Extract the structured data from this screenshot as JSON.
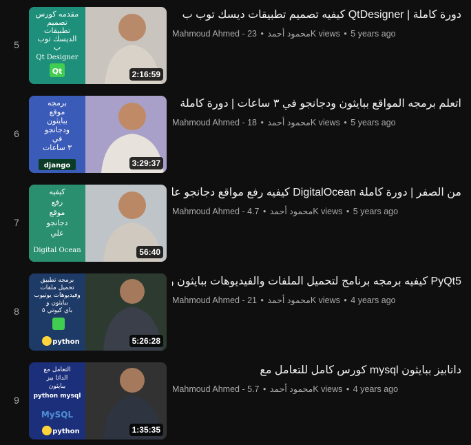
{
  "videos": [
    {
      "index": "5",
      "title": "دورة كاملة | QtDesigner كيفيه تصميم تطبيقات ديسك توب ب",
      "channel": "Mahmoud Ahmed - محمود أحمد",
      "views": "23K views",
      "age": "5 years ago",
      "duration": "2:16:59",
      "thumb_text": [
        "مقدمه كورس",
        "تصميم",
        "تطبيقات",
        "الديسك توب",
        "ب",
        "Qt Designer"
      ],
      "badge": "Qt",
      "panel_color": "#1d8f7a"
    },
    {
      "index": "6",
      "title": "اتعلم برمجه المواقع ببايثون ودجانجو في ٣ ساعات | دورة كاملة",
      "channel": "Mahmoud Ahmed - محمود أحمد",
      "views": "18K views",
      "age": "5 years ago",
      "duration": "3:29:37",
      "thumb_text": [
        "برمجه",
        "موقع",
        "ببايثون",
        "ودجانجو",
        "في",
        "٣ ساعات"
      ],
      "badge": "django",
      "panel_color": "#3b5bb8"
    },
    {
      "index": "7",
      "title": "من الصفر | دورة كاملة DigitalOcean كيفيه رفع مواقع دجانجو علي",
      "channel": "Mahmoud Ahmed - محمود أحمد",
      "views": "4.7K views",
      "age": "5 years ago",
      "duration": "56:40",
      "thumb_text": [
        "كيفيه",
        "رفع",
        "موقع",
        "دجانجو",
        "علي",
        "Digital Ocean"
      ],
      "badge": "",
      "panel_color": "#2a8f6e"
    },
    {
      "index": "8",
      "title": "PyQt5 كيفيه برمجه برنامج لتحميل الملفات والفيديوهات ببايثون و",
      "channel": "Mahmoud Ahmed - محمود أحمد",
      "views": "21K views",
      "age": "4 years ago",
      "duration": "5:26:28",
      "thumb_text": [
        "برمجه تطبيق",
        "تحميل ملفات",
        "وفيديوهات يوتيوب",
        "ببايثون و",
        "باي كيوتي ٥"
      ],
      "badge": "python",
      "panel_color": "#1e3a66"
    },
    {
      "index": "9",
      "title": "داتابيز ببايثون mysql كورس كامل للتعامل مع",
      "channel": "Mahmoud Ahmed - محمود أحمد",
      "views": "5.7K views",
      "age": "4 years ago",
      "duration": "1:35:35",
      "thumb_text": [
        "التعامل مع",
        "الداتا بيز",
        "ببايثون",
        "python mysql",
        "MySQL"
      ],
      "badge": "python",
      "panel_color": "#1c2f7a"
    }
  ],
  "colors": {
    "background": "#0f0f0f",
    "title": "#f1f1f1",
    "meta": "#aaaaaa"
  }
}
